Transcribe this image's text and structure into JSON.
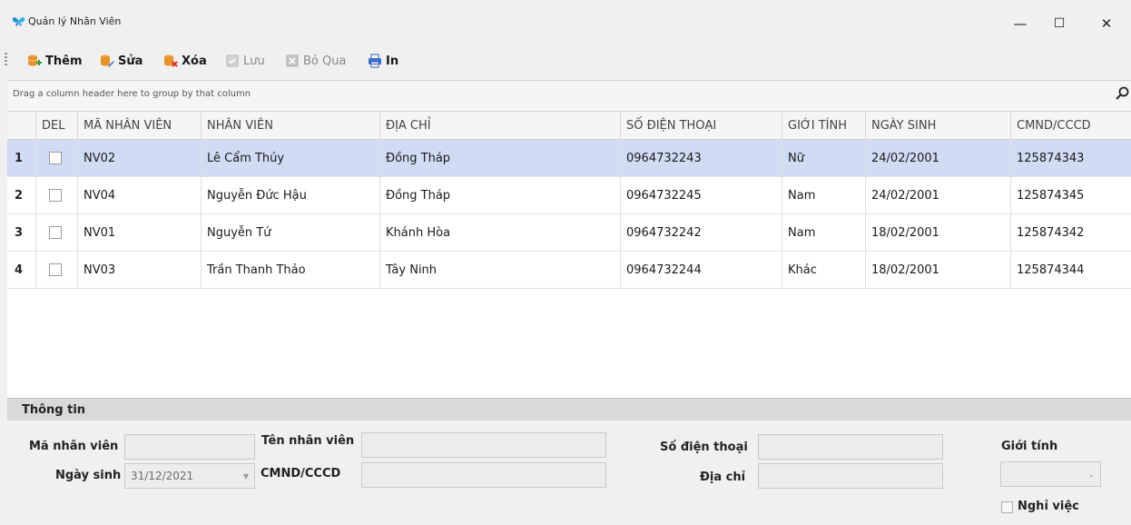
{
  "window": {
    "title": "Quản lý Nhân Viên",
    "minimize": "—",
    "maximize": "☐",
    "close": "✕"
  },
  "toolbar": {
    "add_label": "Thêm",
    "edit_label": "Sửa",
    "delete_label": "Xóa",
    "save_label": "Lưu",
    "skip_label": "Bỏ Qua",
    "print_label": "In"
  },
  "grid": {
    "group_hint": "Drag a column header here to group by that column",
    "headers": {
      "del": "DEL",
      "ma_nv": "MÃ NHÂN VIÊN",
      "nhan_vien": "NHÂN VIÊN",
      "dia_chi": "ĐỊA CHỈ",
      "sdt": "SỐ ĐIỆN THOẠI",
      "gioi_tinh": "GIỚI TÍNH",
      "ngay_sinh": "NGÀY SINH",
      "cmnd": "CMND/CCCD"
    },
    "rows": [
      {
        "num": "1",
        "ma_nv": "NV02",
        "nhan_vien": "Lê Cẩm Thúy",
        "dia_chi": "Đồng Tháp",
        "sdt": "0964732243",
        "gioi_tinh": "Nữ",
        "ngay_sinh": "24/02/2001",
        "cmnd": "125874343"
      },
      {
        "num": "2",
        "ma_nv": "NV04",
        "nhan_vien": "Nguyễn Đức Hậu",
        "dia_chi": "Đồng Tháp",
        "sdt": "0964732245",
        "gioi_tinh": "Nam",
        "ngay_sinh": "24/02/2001",
        "cmnd": "125874345"
      },
      {
        "num": "3",
        "ma_nv": "NV01",
        "nhan_vien": "Nguyễn Tứ",
        "dia_chi": "Khánh Hòa",
        "sdt": "0964732242",
        "gioi_tinh": "Nam",
        "ngay_sinh": "18/02/2001",
        "cmnd": "125874342"
      },
      {
        "num": "4",
        "ma_nv": "NV03",
        "nhan_vien": "Trần Thanh Thảo",
        "dia_chi": "Tây Ninh",
        "sdt": "0964732244",
        "gioi_tinh": "Khác",
        "ngay_sinh": "18/02/2001",
        "cmnd": "125874344"
      }
    ]
  },
  "info": {
    "title": "Thông tin",
    "ma_nv_label": "Mã nhân viên",
    "ten_nv_label": "Tên nhân viên",
    "sdt_label": "Số điện thoại",
    "gioi_tinh_label": "Giới tính",
    "ngay_sinh_label": "Ngày sinh",
    "ngay_sinh_value": "31/12/2021",
    "cmnd_label": "CMND/CCCD",
    "dia_chi_label": "Địa chỉ",
    "nghi_viec_label": "Nghỉ việc"
  },
  "colors": {
    "selected_row": "#cfdcf4",
    "background": "#f0f0f0"
  }
}
